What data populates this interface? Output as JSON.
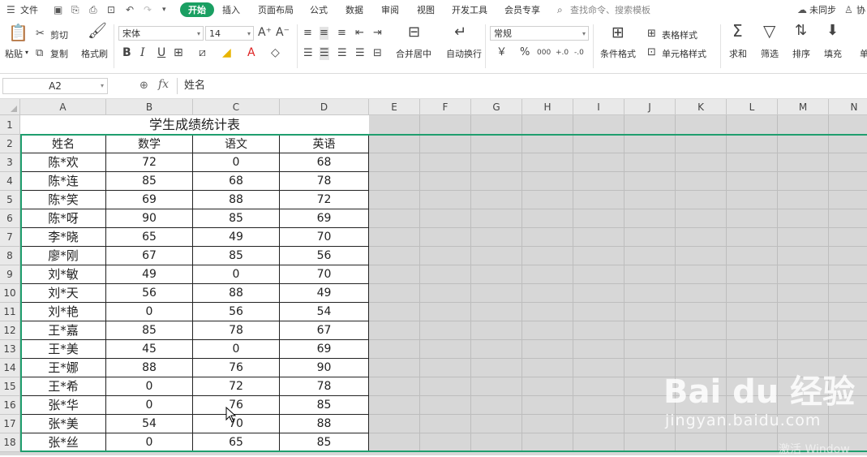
{
  "menu": {
    "file": "文件",
    "tabs": [
      "开始",
      "插入",
      "页面布局",
      "公式",
      "数据",
      "审阅",
      "视图",
      "开发工具",
      "会员专享"
    ],
    "search": "查找命令、搜索模板",
    "sync": "未同步",
    "collab": "协"
  },
  "ribbon": {
    "paste": "粘贴",
    "cut": "剪切",
    "copy": "复制",
    "format_painter": "格式刷",
    "font_name": "宋体",
    "font_size": "14",
    "merge_center": "合并居中",
    "wrap_text": "自动换行",
    "number_format": "常规",
    "conditional_format": "条件格式",
    "table_style": "表格样式",
    "cell_style": "单元格样式",
    "sum": "求和",
    "filter": "筛选",
    "sort": "排序",
    "fill": "填充",
    "more": "单"
  },
  "formula_bar": {
    "cell_ref": "A2",
    "fx": "fx",
    "content": "姓名"
  },
  "columns": [
    "A",
    "B",
    "C",
    "D",
    "E",
    "F",
    "G",
    "H",
    "I",
    "J",
    "K",
    "L",
    "M",
    "N"
  ],
  "rows": [
    "1",
    "2",
    "3",
    "4",
    "5",
    "6",
    "7",
    "8",
    "9",
    "10",
    "11",
    "12",
    "13",
    "14",
    "15",
    "16",
    "17",
    "18"
  ],
  "sheet": {
    "title": "学生成绩统计表",
    "headers": [
      "姓名",
      "数学",
      "语文",
      "英语"
    ],
    "records": [
      [
        "陈*欢",
        "72",
        "0",
        "68"
      ],
      [
        "陈*连",
        "85",
        "68",
        "78"
      ],
      [
        "陈*笑",
        "69",
        "88",
        "72"
      ],
      [
        "陈*呀",
        "90",
        "85",
        "69"
      ],
      [
        "李*晓",
        "65",
        "49",
        "70"
      ],
      [
        "廖*刚",
        "67",
        "85",
        "56"
      ],
      [
        "刘*敏",
        "49",
        "0",
        "70"
      ],
      [
        "刘*天",
        "56",
        "88",
        "49"
      ],
      [
        "刘*艳",
        "0",
        "56",
        "54"
      ],
      [
        "王*嘉",
        "85",
        "78",
        "67"
      ],
      [
        "王*美",
        "45",
        "0",
        "69"
      ],
      [
        "王*娜",
        "88",
        "76",
        "90"
      ],
      [
        "王*希",
        "0",
        "72",
        "78"
      ],
      [
        "张*华",
        "0",
        "76",
        "85"
      ],
      [
        "张*美",
        "54",
        "70",
        "88"
      ],
      [
        "张*丝",
        "0",
        "65",
        "85"
      ]
    ]
  },
  "watermark": {
    "logo": "Bai du 经验",
    "url": "jingyan.baidu.com",
    "activate": "激活 Window"
  },
  "colors": {
    "accent": "#1a9f62",
    "selection": "#1f9e6e",
    "grid_fill": "#d7d7d7"
  }
}
